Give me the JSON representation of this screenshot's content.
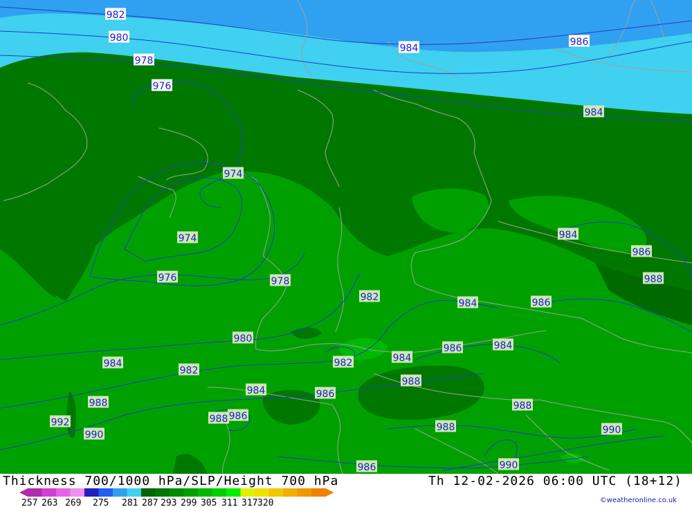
{
  "map": {
    "title_left": "Thickness 700/1000 hPa/SLP/Height 700 hPa",
    "title_right": "Th 12-02-2026 06:00 UTC (18+12)",
    "copyright": "©weatheronline.co.uk",
    "isobar_labels": [
      {
        "text": "982",
        "cls": "w"
      },
      {
        "text": "980",
        "cls": "w"
      },
      {
        "text": "978",
        "cls": "w"
      },
      {
        "text": "976",
        "cls": "w"
      },
      {
        "text": "984",
        "cls": "w"
      },
      {
        "text": "986",
        "cls": "w"
      },
      {
        "text": "984",
        "cls": "g"
      },
      {
        "text": "974",
        "cls": "g"
      },
      {
        "text": "974",
        "cls": "g"
      },
      {
        "text": "976",
        "cls": "g"
      },
      {
        "text": "978",
        "cls": "g"
      },
      {
        "text": "982",
        "cls": "g"
      },
      {
        "text": "984",
        "cls": "g"
      },
      {
        "text": "986",
        "cls": "g"
      },
      {
        "text": "984",
        "cls": "g"
      },
      {
        "text": "986",
        "cls": "g"
      },
      {
        "text": "988",
        "cls": "g"
      },
      {
        "text": "980",
        "cls": "g"
      },
      {
        "text": "986",
        "cls": "g"
      },
      {
        "text": "984",
        "cls": "g"
      },
      {
        "text": "984",
        "cls": "g"
      },
      {
        "text": "982",
        "cls": "g"
      },
      {
        "text": "984",
        "cls": "g"
      },
      {
        "text": "982",
        "cls": "g"
      },
      {
        "text": "988",
        "cls": "g"
      },
      {
        "text": "984",
        "cls": "g"
      },
      {
        "text": "986",
        "cls": "g"
      },
      {
        "text": "988",
        "cls": "g"
      },
      {
        "text": "992",
        "cls": "g"
      },
      {
        "text": "988",
        "cls": "g"
      },
      {
        "text": "986",
        "cls": "g"
      },
      {
        "text": "990",
        "cls": "g"
      },
      {
        "text": "988",
        "cls": "g"
      },
      {
        "text": "988",
        "cls": "g"
      },
      {
        "text": "990",
        "cls": "g"
      },
      {
        "text": "986",
        "cls": "g"
      },
      {
        "text": "990",
        "cls": "g"
      }
    ]
  },
  "legend": {
    "ticks": [
      "257",
      "263",
      "269",
      "275",
      "281",
      "287",
      "293",
      "299",
      "305",
      "311",
      "317",
      "320"
    ],
    "colors": [
      "#b02ab0",
      "#d040d0",
      "#e860e8",
      "#f090f0",
      "#2020c0",
      "#2060f0",
      "#30a0f0",
      "#40d0f0",
      "#006400",
      "#007800",
      "#008c00",
      "#00a000",
      "#00b800",
      "#00d000",
      "#00f000",
      "#e0f000",
      "#f0e000",
      "#f0c800",
      "#f0b000",
      "#f09800",
      "#f08000"
    ]
  }
}
